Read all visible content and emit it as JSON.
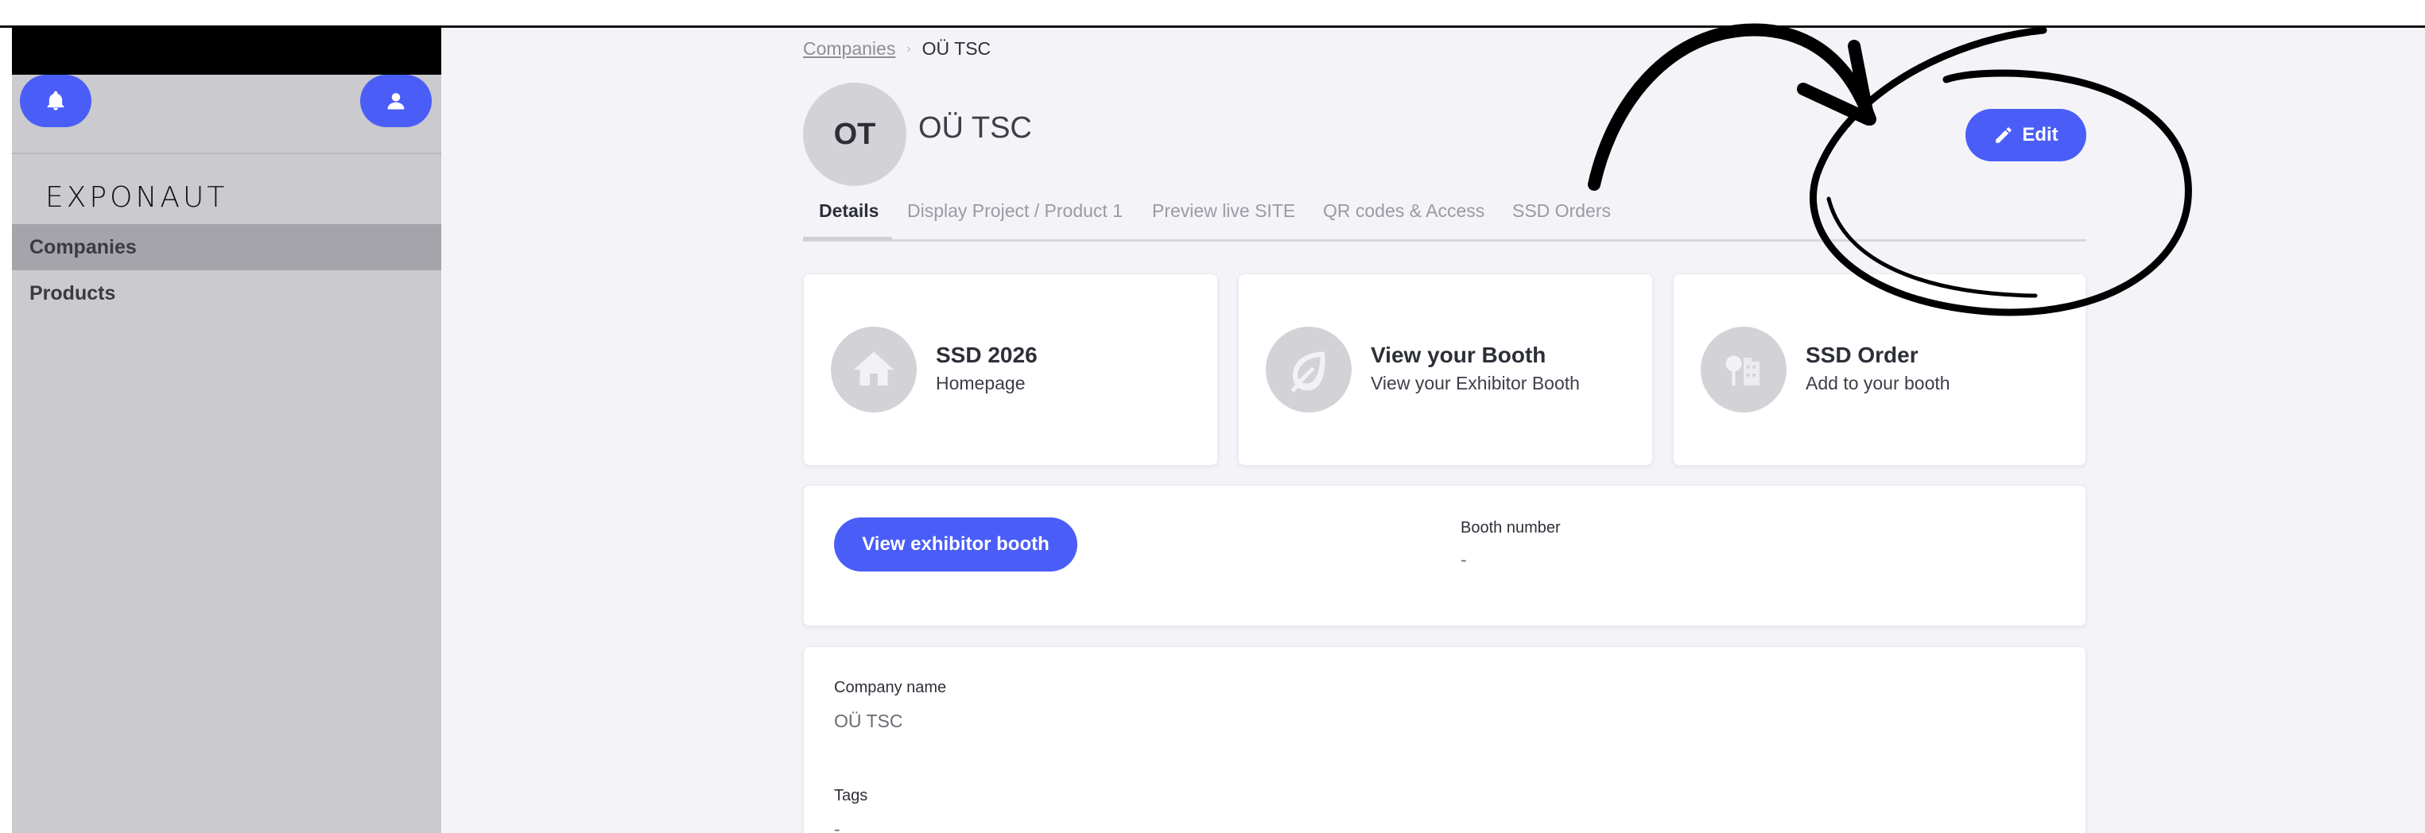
{
  "sidebar": {
    "logo": "EXPONAUT",
    "items": [
      {
        "label": "Companies",
        "active": true
      },
      {
        "label": "Products",
        "active": false
      }
    ]
  },
  "breadcrumb": {
    "parent": "Companies",
    "current": "OÜ TSC"
  },
  "company": {
    "initials": "OT",
    "name": "OÜ TSC"
  },
  "header": {
    "edit_label": "Edit"
  },
  "tabs": [
    {
      "label": "Details",
      "active": true
    },
    {
      "label": "Display Project / Product 1",
      "active": false
    },
    {
      "label": "Preview live SITE",
      "active": false
    },
    {
      "label": "QR codes & Access",
      "active": false
    },
    {
      "label": "SSD Orders",
      "active": false
    }
  ],
  "tiles": [
    {
      "title": "SSD 2026",
      "subtitle": "Homepage",
      "icon": "house-icon"
    },
    {
      "title": "View your Booth",
      "subtitle": "View your Exhibitor Booth",
      "icon": "leaf-icon"
    },
    {
      "title": "SSD Order",
      "subtitle": "Add to your booth",
      "icon": "tree-building-icon"
    }
  ],
  "booth": {
    "button_label": "View exhibitor booth",
    "number_label": "Booth number",
    "number_value": "-"
  },
  "details": {
    "company_name_label": "Company name",
    "company_name_value": "OÜ TSC",
    "tags_label": "Tags",
    "tags_value": "-"
  },
  "colors": {
    "accent": "#4a5ef7",
    "sidebar": "#cbcace",
    "sidebar_active": "#a5a4aa",
    "main_bg": "#f4f3f8"
  }
}
